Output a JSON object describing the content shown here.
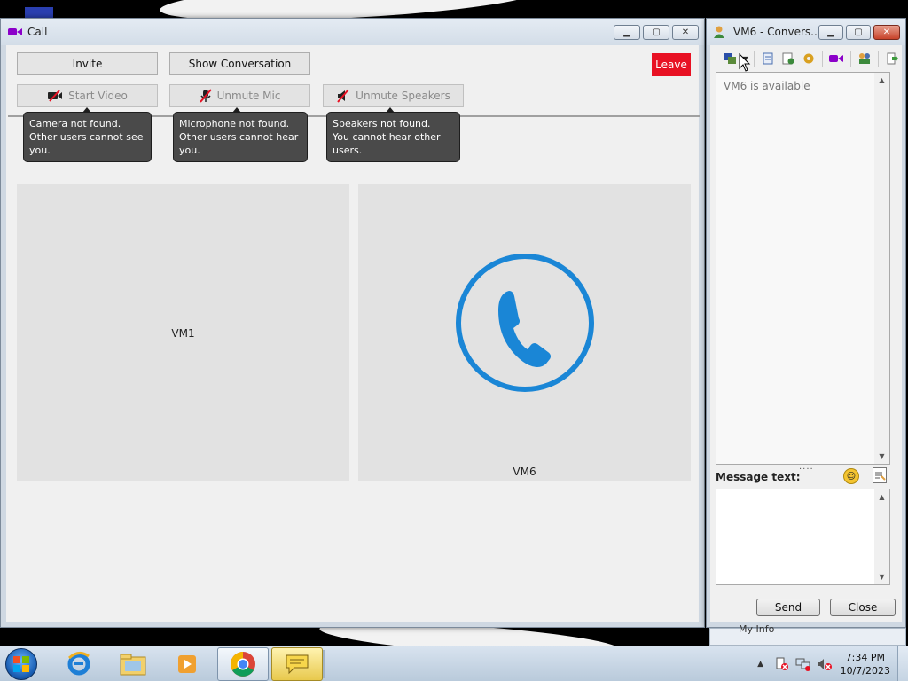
{
  "call_window": {
    "title": "Call",
    "buttons": {
      "invite": "Invite",
      "show_conversation": "Show Conversation",
      "leave": "Leave",
      "start_video": "Start Video",
      "unmute_mic": "Unmute Mic",
      "unmute_speakers": "Unmute Speakers"
    },
    "tooltips": {
      "camera": [
        "Camera not found.",
        "Other users cannot see you."
      ],
      "microphone": [
        "Microphone not found.",
        "Other users cannot hear you."
      ],
      "speakers": [
        "Speakers not found.",
        "You cannot hear other users."
      ]
    },
    "tiles": {
      "local_label": "VM1",
      "remote_label": "VM6"
    },
    "colors": {
      "leave": "#e81123",
      "phone_icon": "#1a86d6",
      "video_icon": "#8b00c9"
    }
  },
  "conversation_window": {
    "title": "VM6 - Convers...",
    "status_text": "VM6 is available",
    "message_label": "Message text:",
    "resize_grip": "....",
    "send": "Send",
    "close": "Close",
    "behind_text": "My Info",
    "toolbar_icons": [
      "contacts-icon",
      "dropdown-icon",
      "history-icon",
      "info-icon",
      "settings-icon",
      "video-icon",
      "add-users-icon",
      "exit-icon"
    ]
  },
  "taskbar": {
    "apps": [
      "internet-explorer-icon",
      "file-explorer-icon",
      "media-player-icon",
      "chrome-icon",
      "chat-app-icon"
    ],
    "tray_icons": [
      "show-hidden-icon",
      "action-center-icon",
      "network-icon",
      "volume-muted-icon"
    ],
    "time": "7:34 PM",
    "date": "10/7/2023"
  }
}
